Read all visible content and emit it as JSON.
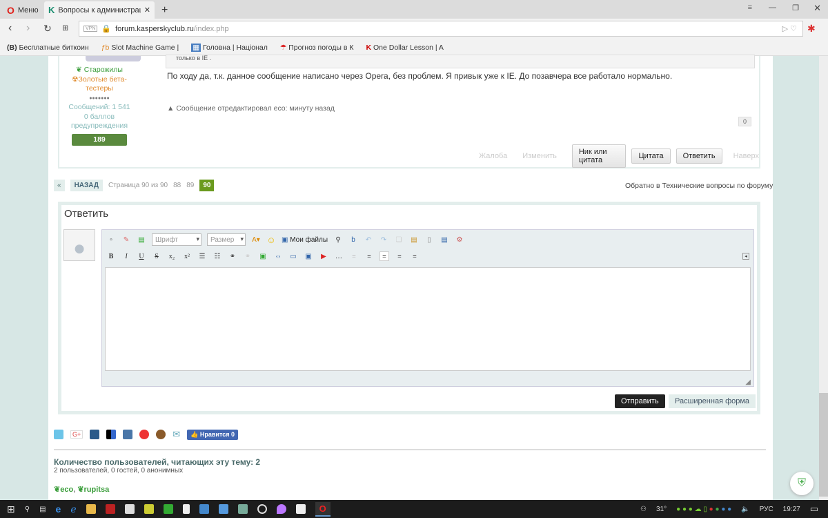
{
  "browser": {
    "menu_label": "Меню",
    "tab_title": "Вопросы к администраци",
    "new_tab": "+",
    "url_host": "forum.kasperskyclub.ru",
    "url_path": "/index.php",
    "vpn_label": "VPN",
    "bookmarks": [
      {
        "icon": "(B)",
        "label": "Бесплатные биткоин"
      },
      {
        "icon": "fb",
        "label": "Slot Machine Game |"
      },
      {
        "icon": "nb",
        "label": "Головна | Націонал"
      },
      {
        "icon": "umbrella",
        "label": "Прогноз погоды в К"
      },
      {
        "icon": "K",
        "label": "One Dollar Lesson | A"
      }
    ]
  },
  "post": {
    "quote_fragment": "только в IE .",
    "author_group": "Старожилы",
    "author_badge": "Золотые бета-тестеры",
    "rank_dots": "●●●●●●●",
    "posts_count": "Сообщений: 1 541",
    "warnings": "0 баллов предупреждения",
    "reputation": "189",
    "body": "По ходу да, т.к. данное сообщение написано через Opera, без проблем. Я привык уже к IE. До позавчера все работало нормально.",
    "edited_note": "Сообщение отредактировал eco: минуту назад",
    "rep_count": "0",
    "actions": {
      "report": "Жалоба",
      "edit": "Изменить",
      "nick_quote": "Ник или цитата",
      "quote": "Цитата",
      "reply": "Ответить",
      "top": "Наверх"
    }
  },
  "pagination": {
    "first": "«",
    "back": "НАЗАД",
    "page_info": "Страница 90 из 90",
    "pages": [
      "88",
      "89"
    ],
    "current": "90",
    "back_to_forum": "Обратно в Технические вопросы по форуму"
  },
  "reply_form": {
    "title": "Ответить",
    "font_placeholder": "Шрифт",
    "size_placeholder": "Размер",
    "my_files": "Мои файлы",
    "submit": "Отправить",
    "advanced": "Расширенная форма"
  },
  "social": {
    "like_label": "Нравится 0"
  },
  "readers": {
    "title": "Количество пользователей, читающих эту тему: 2",
    "summary": "2 пользователей, 0 гостей, 0 анонимных",
    "users": [
      "eco",
      "rupitsa"
    ],
    "sep": ","
  },
  "taskbar": {
    "temp": "31°",
    "lang": "РУС",
    "time": "19:27"
  }
}
